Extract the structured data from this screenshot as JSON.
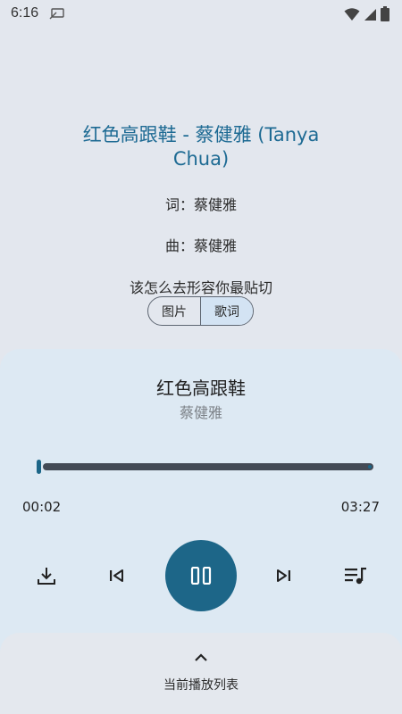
{
  "status_bar": {
    "time": "6:16",
    "icons": [
      "notification-icon",
      "wifi-icon",
      "signal-icon",
      "battery-icon"
    ]
  },
  "lyrics_view": {
    "heading": "红色高跟鞋 - 蔡健雅 (Tanya Chua)",
    "lines": [
      "词：蔡健雅",
      "曲：蔡健雅",
      "该怎么去形容你最贴切"
    ],
    "toggle": {
      "options": [
        "图片",
        "歌词"
      ],
      "selected": "歌词"
    }
  },
  "player": {
    "title": "红色高跟鞋",
    "artist": "蔡健雅",
    "time_current": "00:02",
    "time_total": "03:27",
    "progress_fraction": 0.01,
    "controls": [
      "download-icon",
      "skip-previous-icon",
      "pause-icon",
      "skip-next-icon",
      "queue-music-icon"
    ]
  },
  "queue": {
    "label": "当前播放列表",
    "icon": "chevron-up-icon"
  },
  "colors": {
    "accent": "#1d6688",
    "heading": "#1d6a93",
    "background": "#e3e7ee",
    "panel": "#dde9f3"
  }
}
